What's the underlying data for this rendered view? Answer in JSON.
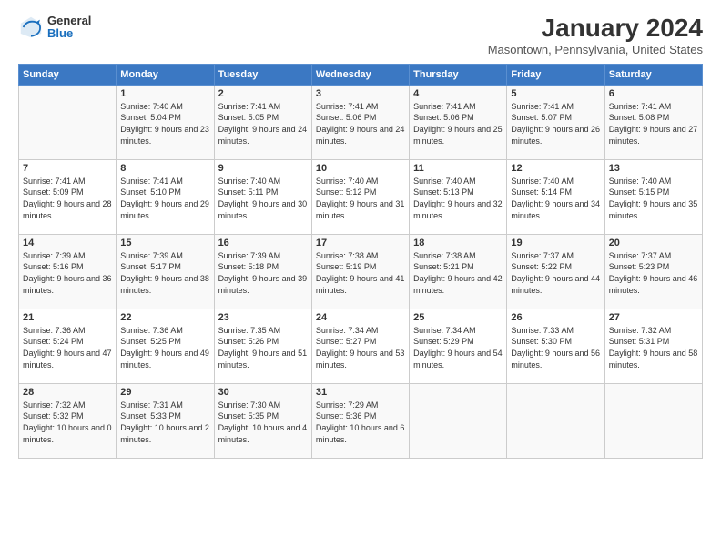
{
  "header": {
    "logo_general": "General",
    "logo_blue": "Blue",
    "month": "January 2024",
    "location": "Masontown, Pennsylvania, United States"
  },
  "weekdays": [
    "Sunday",
    "Monday",
    "Tuesday",
    "Wednesday",
    "Thursday",
    "Friday",
    "Saturday"
  ],
  "weeks": [
    [
      {
        "day": "",
        "sunrise": "",
        "sunset": "",
        "daylight": ""
      },
      {
        "day": "1",
        "sunrise": "Sunrise: 7:40 AM",
        "sunset": "Sunset: 5:04 PM",
        "daylight": "Daylight: 9 hours and 23 minutes."
      },
      {
        "day": "2",
        "sunrise": "Sunrise: 7:41 AM",
        "sunset": "Sunset: 5:05 PM",
        "daylight": "Daylight: 9 hours and 24 minutes."
      },
      {
        "day": "3",
        "sunrise": "Sunrise: 7:41 AM",
        "sunset": "Sunset: 5:06 PM",
        "daylight": "Daylight: 9 hours and 24 minutes."
      },
      {
        "day": "4",
        "sunrise": "Sunrise: 7:41 AM",
        "sunset": "Sunset: 5:06 PM",
        "daylight": "Daylight: 9 hours and 25 minutes."
      },
      {
        "day": "5",
        "sunrise": "Sunrise: 7:41 AM",
        "sunset": "Sunset: 5:07 PM",
        "daylight": "Daylight: 9 hours and 26 minutes."
      },
      {
        "day": "6",
        "sunrise": "Sunrise: 7:41 AM",
        "sunset": "Sunset: 5:08 PM",
        "daylight": "Daylight: 9 hours and 27 minutes."
      }
    ],
    [
      {
        "day": "7",
        "sunrise": "Sunrise: 7:41 AM",
        "sunset": "Sunset: 5:09 PM",
        "daylight": "Daylight: 9 hours and 28 minutes."
      },
      {
        "day": "8",
        "sunrise": "Sunrise: 7:41 AM",
        "sunset": "Sunset: 5:10 PM",
        "daylight": "Daylight: 9 hours and 29 minutes."
      },
      {
        "day": "9",
        "sunrise": "Sunrise: 7:40 AM",
        "sunset": "Sunset: 5:11 PM",
        "daylight": "Daylight: 9 hours and 30 minutes."
      },
      {
        "day": "10",
        "sunrise": "Sunrise: 7:40 AM",
        "sunset": "Sunset: 5:12 PM",
        "daylight": "Daylight: 9 hours and 31 minutes."
      },
      {
        "day": "11",
        "sunrise": "Sunrise: 7:40 AM",
        "sunset": "Sunset: 5:13 PM",
        "daylight": "Daylight: 9 hours and 32 minutes."
      },
      {
        "day": "12",
        "sunrise": "Sunrise: 7:40 AM",
        "sunset": "Sunset: 5:14 PM",
        "daylight": "Daylight: 9 hours and 34 minutes."
      },
      {
        "day": "13",
        "sunrise": "Sunrise: 7:40 AM",
        "sunset": "Sunset: 5:15 PM",
        "daylight": "Daylight: 9 hours and 35 minutes."
      }
    ],
    [
      {
        "day": "14",
        "sunrise": "Sunrise: 7:39 AM",
        "sunset": "Sunset: 5:16 PM",
        "daylight": "Daylight: 9 hours and 36 minutes."
      },
      {
        "day": "15",
        "sunrise": "Sunrise: 7:39 AM",
        "sunset": "Sunset: 5:17 PM",
        "daylight": "Daylight: 9 hours and 38 minutes."
      },
      {
        "day": "16",
        "sunrise": "Sunrise: 7:39 AM",
        "sunset": "Sunset: 5:18 PM",
        "daylight": "Daylight: 9 hours and 39 minutes."
      },
      {
        "day": "17",
        "sunrise": "Sunrise: 7:38 AM",
        "sunset": "Sunset: 5:19 PM",
        "daylight": "Daylight: 9 hours and 41 minutes."
      },
      {
        "day": "18",
        "sunrise": "Sunrise: 7:38 AM",
        "sunset": "Sunset: 5:21 PM",
        "daylight": "Daylight: 9 hours and 42 minutes."
      },
      {
        "day": "19",
        "sunrise": "Sunrise: 7:37 AM",
        "sunset": "Sunset: 5:22 PM",
        "daylight": "Daylight: 9 hours and 44 minutes."
      },
      {
        "day": "20",
        "sunrise": "Sunrise: 7:37 AM",
        "sunset": "Sunset: 5:23 PM",
        "daylight": "Daylight: 9 hours and 46 minutes."
      }
    ],
    [
      {
        "day": "21",
        "sunrise": "Sunrise: 7:36 AM",
        "sunset": "Sunset: 5:24 PM",
        "daylight": "Daylight: 9 hours and 47 minutes."
      },
      {
        "day": "22",
        "sunrise": "Sunrise: 7:36 AM",
        "sunset": "Sunset: 5:25 PM",
        "daylight": "Daylight: 9 hours and 49 minutes."
      },
      {
        "day": "23",
        "sunrise": "Sunrise: 7:35 AM",
        "sunset": "Sunset: 5:26 PM",
        "daylight": "Daylight: 9 hours and 51 minutes."
      },
      {
        "day": "24",
        "sunrise": "Sunrise: 7:34 AM",
        "sunset": "Sunset: 5:27 PM",
        "daylight": "Daylight: 9 hours and 53 minutes."
      },
      {
        "day": "25",
        "sunrise": "Sunrise: 7:34 AM",
        "sunset": "Sunset: 5:29 PM",
        "daylight": "Daylight: 9 hours and 54 minutes."
      },
      {
        "day": "26",
        "sunrise": "Sunrise: 7:33 AM",
        "sunset": "Sunset: 5:30 PM",
        "daylight": "Daylight: 9 hours and 56 minutes."
      },
      {
        "day": "27",
        "sunrise": "Sunrise: 7:32 AM",
        "sunset": "Sunset: 5:31 PM",
        "daylight": "Daylight: 9 hours and 58 minutes."
      }
    ],
    [
      {
        "day": "28",
        "sunrise": "Sunrise: 7:32 AM",
        "sunset": "Sunset: 5:32 PM",
        "daylight": "Daylight: 10 hours and 0 minutes."
      },
      {
        "day": "29",
        "sunrise": "Sunrise: 7:31 AM",
        "sunset": "Sunset: 5:33 PM",
        "daylight": "Daylight: 10 hours and 2 minutes."
      },
      {
        "day": "30",
        "sunrise": "Sunrise: 7:30 AM",
        "sunset": "Sunset: 5:35 PM",
        "daylight": "Daylight: 10 hours and 4 minutes."
      },
      {
        "day": "31",
        "sunrise": "Sunrise: 7:29 AM",
        "sunset": "Sunset: 5:36 PM",
        "daylight": "Daylight: 10 hours and 6 minutes."
      },
      {
        "day": "",
        "sunrise": "",
        "sunset": "",
        "daylight": ""
      },
      {
        "day": "",
        "sunrise": "",
        "sunset": "",
        "daylight": ""
      },
      {
        "day": "",
        "sunrise": "",
        "sunset": "",
        "daylight": ""
      }
    ]
  ]
}
